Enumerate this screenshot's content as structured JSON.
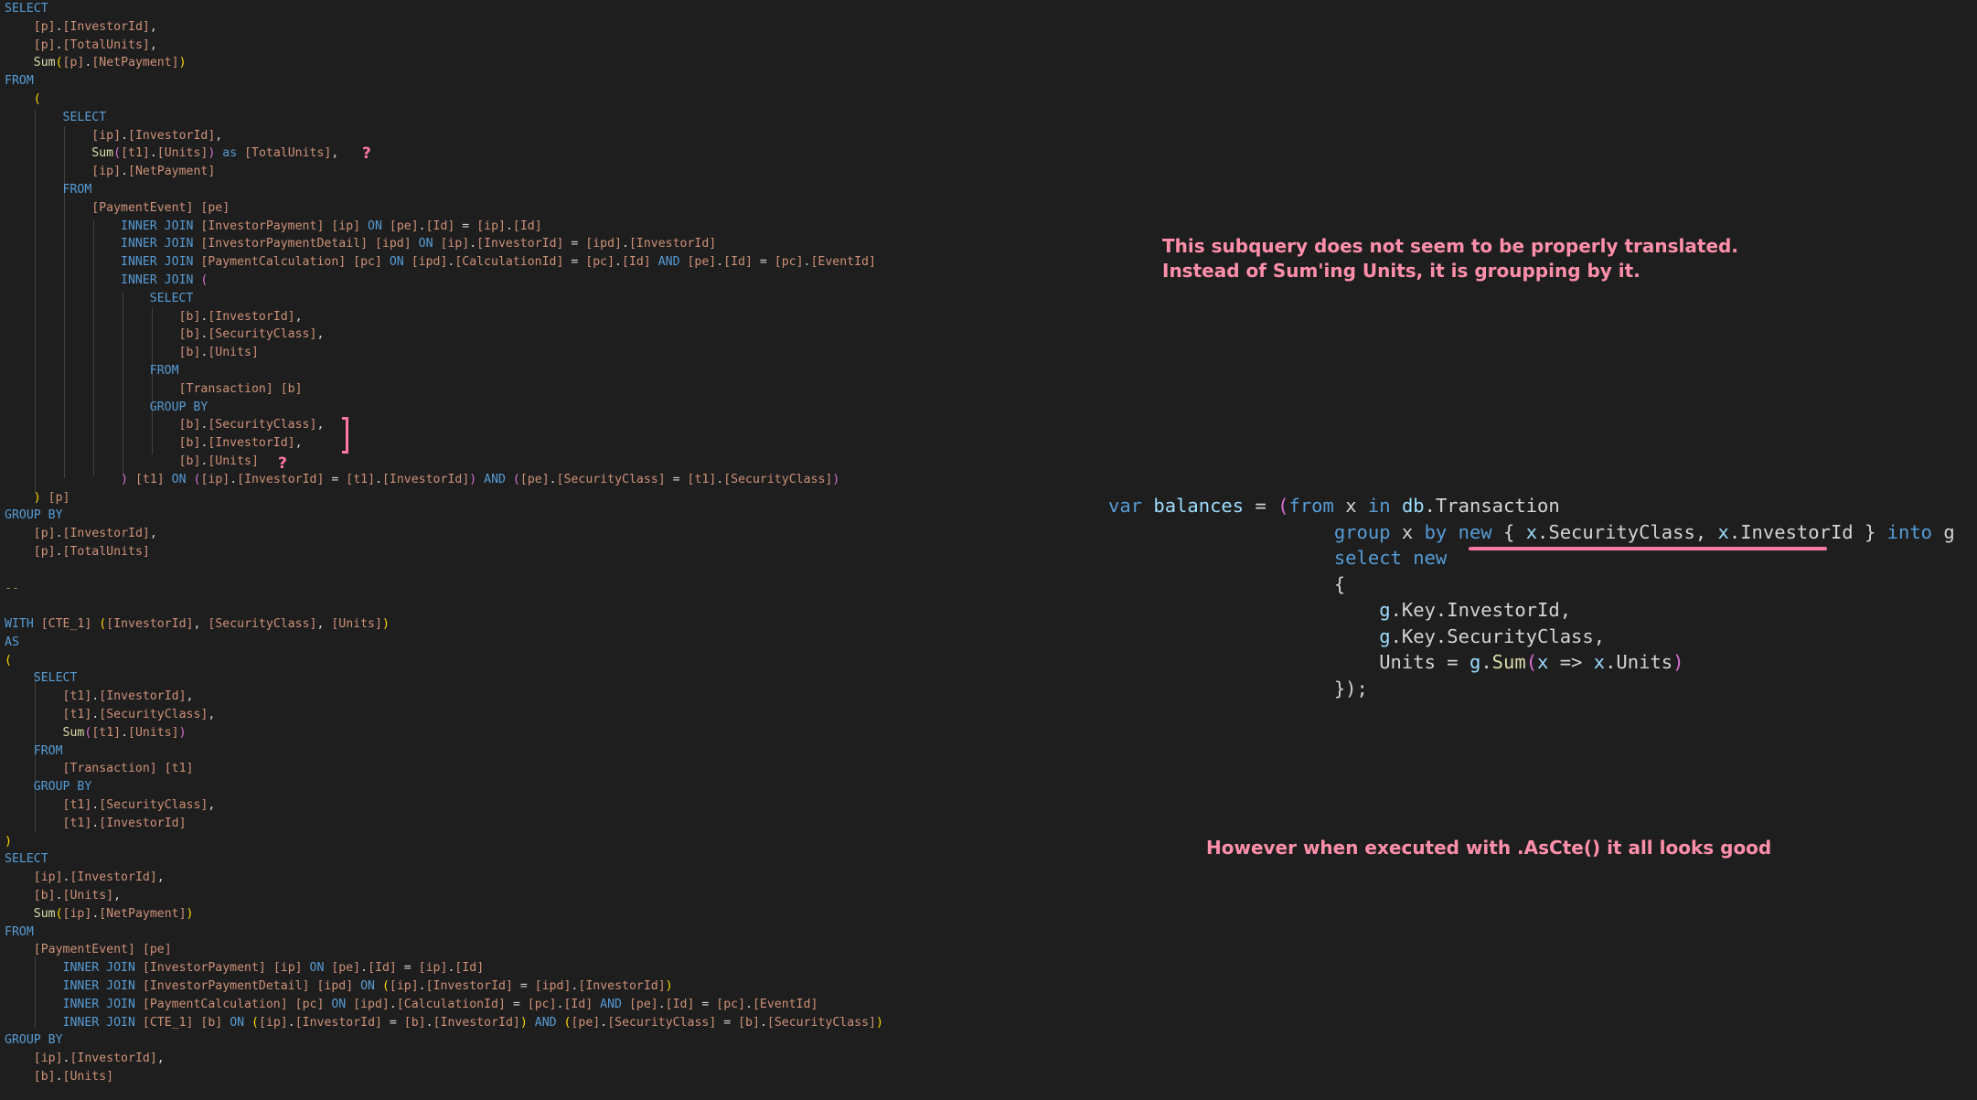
{
  "sql_lines": [
    [
      [
        "SELECT",
        "kw"
      ]
    ],
    [
      [
        "    ",
        ""
      ],
      [
        "[p]",
        "br"
      ],
      [
        ".",
        "pn"
      ],
      [
        "[InvestorId]",
        "br"
      ],
      [
        ",",
        "pn"
      ]
    ],
    [
      [
        "    ",
        ""
      ],
      [
        "[p]",
        "br"
      ],
      [
        ".",
        "pn"
      ],
      [
        "[TotalUnits]",
        "br"
      ],
      [
        ",",
        "pn"
      ]
    ],
    [
      [
        "    ",
        ""
      ],
      [
        "Sum",
        "fn"
      ],
      [
        "(",
        "pa1"
      ],
      [
        "[p]",
        "br"
      ],
      [
        ".",
        "pn"
      ],
      [
        "[NetPayment]",
        "br"
      ],
      [
        ")",
        "pa1"
      ]
    ],
    [
      [
        "FROM",
        "kw"
      ]
    ],
    [
      [
        "    ",
        ""
      ],
      [
        "(",
        "pa1"
      ]
    ],
    [
      [
        "        ",
        ""
      ],
      [
        "SELECT",
        "kw"
      ]
    ],
    [
      [
        "            ",
        ""
      ],
      [
        "[ip]",
        "br"
      ],
      [
        ".",
        "pn"
      ],
      [
        "[InvestorId]",
        "br"
      ],
      [
        ",",
        "pn"
      ]
    ],
    [
      [
        "            ",
        ""
      ],
      [
        "Sum",
        "fn"
      ],
      [
        "(",
        "pa2"
      ],
      [
        "[t1]",
        "br"
      ],
      [
        ".",
        "pn"
      ],
      [
        "[Units]",
        "br"
      ],
      [
        ")",
        "pa2"
      ],
      [
        " as ",
        "kw"
      ],
      [
        "[TotalUnits]",
        "br"
      ],
      [
        ",",
        "pn"
      ]
    ],
    [
      [
        "            ",
        ""
      ],
      [
        "[ip]",
        "br"
      ],
      [
        ".",
        "pn"
      ],
      [
        "[NetPayment]",
        "br"
      ]
    ],
    [
      [
        "        ",
        ""
      ],
      [
        "FROM",
        "kw"
      ]
    ],
    [
      [
        "            ",
        ""
      ],
      [
        "[PaymentEvent]",
        "br"
      ],
      [
        " ",
        ""
      ],
      [
        "[pe]",
        "br"
      ]
    ],
    [
      [
        "                ",
        ""
      ],
      [
        "INNER JOIN",
        "kw"
      ],
      [
        " ",
        ""
      ],
      [
        "[InvestorPayment]",
        "br"
      ],
      [
        " ",
        ""
      ],
      [
        "[ip]",
        "br"
      ],
      [
        " ON ",
        "kw"
      ],
      [
        "[pe]",
        "br"
      ],
      [
        ".",
        "pn"
      ],
      [
        "[Id]",
        "br"
      ],
      [
        " = ",
        "pn"
      ],
      [
        "[ip]",
        "br"
      ],
      [
        ".",
        "pn"
      ],
      [
        "[Id]",
        "br"
      ]
    ],
    [
      [
        "                ",
        ""
      ],
      [
        "INNER JOIN",
        "kw"
      ],
      [
        " ",
        ""
      ],
      [
        "[InvestorPaymentDetail]",
        "br"
      ],
      [
        " ",
        ""
      ],
      [
        "[ipd]",
        "br"
      ],
      [
        " ON ",
        "kw"
      ],
      [
        "[ip]",
        "br"
      ],
      [
        ".",
        "pn"
      ],
      [
        "[InvestorId]",
        "br"
      ],
      [
        " = ",
        "pn"
      ],
      [
        "[ipd]",
        "br"
      ],
      [
        ".",
        "pn"
      ],
      [
        "[InvestorId]",
        "br"
      ]
    ],
    [
      [
        "                ",
        ""
      ],
      [
        "INNER JOIN",
        "kw"
      ],
      [
        " ",
        ""
      ],
      [
        "[PaymentCalculation]",
        "br"
      ],
      [
        " ",
        ""
      ],
      [
        "[pc]",
        "br"
      ],
      [
        " ON ",
        "kw"
      ],
      [
        "[ipd]",
        "br"
      ],
      [
        ".",
        "pn"
      ],
      [
        "[CalculationId]",
        "br"
      ],
      [
        " = ",
        "pn"
      ],
      [
        "[pc]",
        "br"
      ],
      [
        ".",
        "pn"
      ],
      [
        "[Id]",
        "br"
      ],
      [
        " AND ",
        "kw"
      ],
      [
        "[pe]",
        "br"
      ],
      [
        ".",
        "pn"
      ],
      [
        "[Id]",
        "br"
      ],
      [
        " = ",
        "pn"
      ],
      [
        "[pc]",
        "br"
      ],
      [
        ".",
        "pn"
      ],
      [
        "[EventId]",
        "br"
      ]
    ],
    [
      [
        "                ",
        ""
      ],
      [
        "INNER JOIN",
        "kw"
      ],
      [
        " ",
        ""
      ],
      [
        "(",
        "pa2"
      ]
    ],
    [
      [
        "                    ",
        ""
      ],
      [
        "SELECT",
        "kw"
      ]
    ],
    [
      [
        "                        ",
        ""
      ],
      [
        "[b]",
        "br"
      ],
      [
        ".",
        "pn"
      ],
      [
        "[InvestorId]",
        "br"
      ],
      [
        ",",
        "pn"
      ]
    ],
    [
      [
        "                        ",
        ""
      ],
      [
        "[b]",
        "br"
      ],
      [
        ".",
        "pn"
      ],
      [
        "[SecurityClass]",
        "br"
      ],
      [
        ",",
        "pn"
      ]
    ],
    [
      [
        "                        ",
        ""
      ],
      [
        "[b]",
        "br"
      ],
      [
        ".",
        "pn"
      ],
      [
        "[Units]",
        "br"
      ]
    ],
    [
      [
        "                    ",
        ""
      ],
      [
        "FROM",
        "kw"
      ]
    ],
    [
      [
        "                        ",
        ""
      ],
      [
        "[Transaction]",
        "br"
      ],
      [
        " ",
        ""
      ],
      [
        "[b]",
        "br"
      ]
    ],
    [
      [
        "                    ",
        ""
      ],
      [
        "GROUP BY",
        "kw"
      ]
    ],
    [
      [
        "                        ",
        ""
      ],
      [
        "[b]",
        "br"
      ],
      [
        ".",
        "pn"
      ],
      [
        "[SecurityClass]",
        "br"
      ],
      [
        ",",
        "pn"
      ]
    ],
    [
      [
        "                        ",
        ""
      ],
      [
        "[b]",
        "br"
      ],
      [
        ".",
        "pn"
      ],
      [
        "[InvestorId]",
        "br"
      ],
      [
        ",",
        "pn"
      ]
    ],
    [
      [
        "                        ",
        ""
      ],
      [
        "[b]",
        "br"
      ],
      [
        ".",
        "pn"
      ],
      [
        "[Units]",
        "br"
      ]
    ],
    [
      [
        "                ",
        ""
      ],
      [
        ")",
        "pa2"
      ],
      [
        " ",
        ""
      ],
      [
        "[t1]",
        "br"
      ],
      [
        " ON ",
        "kw"
      ],
      [
        "(",
        "pa2"
      ],
      [
        "[ip]",
        "br"
      ],
      [
        ".",
        "pn"
      ],
      [
        "[InvestorId]",
        "br"
      ],
      [
        " = ",
        "pn"
      ],
      [
        "[t1]",
        "br"
      ],
      [
        ".",
        "pn"
      ],
      [
        "[InvestorId]",
        "br"
      ],
      [
        ")",
        "pa2"
      ],
      [
        " AND ",
        "kw"
      ],
      [
        "(",
        "pa2"
      ],
      [
        "[pe]",
        "br"
      ],
      [
        ".",
        "pn"
      ],
      [
        "[SecurityClass]",
        "br"
      ],
      [
        " = ",
        "pn"
      ],
      [
        "[t1]",
        "br"
      ],
      [
        ".",
        "pn"
      ],
      [
        "[SecurityClass]",
        "br"
      ],
      [
        ")",
        "pa2"
      ]
    ],
    [
      [
        "    ",
        ""
      ],
      [
        ")",
        "pa1"
      ],
      [
        " ",
        ""
      ],
      [
        "[p]",
        "br"
      ]
    ],
    [
      [
        "GROUP BY",
        "kw"
      ]
    ],
    [
      [
        "    ",
        ""
      ],
      [
        "[p]",
        "br"
      ],
      [
        ".",
        "pn"
      ],
      [
        "[InvestorId]",
        "br"
      ],
      [
        ",",
        "pn"
      ]
    ],
    [
      [
        "    ",
        ""
      ],
      [
        "[p]",
        "br"
      ],
      [
        ".",
        "pn"
      ],
      [
        "[TotalUnits]",
        "br"
      ]
    ],
    [
      [
        "",
        ""
      ]
    ],
    [
      [
        "--",
        "cm"
      ]
    ],
    [
      [
        "",
        ""
      ]
    ],
    [
      [
        "WITH",
        "kw"
      ],
      [
        " ",
        ""
      ],
      [
        "[CTE_1]",
        "br"
      ],
      [
        " ",
        ""
      ],
      [
        "(",
        "pa1"
      ],
      [
        "[InvestorId]",
        "br"
      ],
      [
        ", ",
        "pn"
      ],
      [
        "[SecurityClass]",
        "br"
      ],
      [
        ", ",
        "pn"
      ],
      [
        "[Units]",
        "br"
      ],
      [
        ")",
        "pa1"
      ]
    ],
    [
      [
        "AS",
        "kw"
      ]
    ],
    [
      [
        "(",
        "pa1"
      ]
    ],
    [
      [
        "    ",
        ""
      ],
      [
        "SELECT",
        "kw"
      ]
    ],
    [
      [
        "        ",
        ""
      ],
      [
        "[t1]",
        "br"
      ],
      [
        ".",
        "pn"
      ],
      [
        "[InvestorId]",
        "br"
      ],
      [
        ",",
        "pn"
      ]
    ],
    [
      [
        "        ",
        ""
      ],
      [
        "[t1]",
        "br"
      ],
      [
        ".",
        "pn"
      ],
      [
        "[SecurityClass]",
        "br"
      ],
      [
        ",",
        "pn"
      ]
    ],
    [
      [
        "        ",
        ""
      ],
      [
        "Sum",
        "fn"
      ],
      [
        "(",
        "pa2"
      ],
      [
        "[t1]",
        "br"
      ],
      [
        ".",
        "pn"
      ],
      [
        "[Units]",
        "br"
      ],
      [
        ")",
        "pa2"
      ]
    ],
    [
      [
        "    ",
        ""
      ],
      [
        "FROM",
        "kw"
      ]
    ],
    [
      [
        "        ",
        ""
      ],
      [
        "[Transaction]",
        "br"
      ],
      [
        " ",
        ""
      ],
      [
        "[t1]",
        "br"
      ]
    ],
    [
      [
        "    ",
        ""
      ],
      [
        "GROUP BY",
        "kw"
      ]
    ],
    [
      [
        "        ",
        ""
      ],
      [
        "[t1]",
        "br"
      ],
      [
        ".",
        "pn"
      ],
      [
        "[SecurityClass]",
        "br"
      ],
      [
        ",",
        "pn"
      ]
    ],
    [
      [
        "        ",
        ""
      ],
      [
        "[t1]",
        "br"
      ],
      [
        ".",
        "pn"
      ],
      [
        "[InvestorId]",
        "br"
      ]
    ],
    [
      [
        ")",
        "pa1"
      ]
    ],
    [
      [
        "SELECT",
        "kw"
      ]
    ],
    [
      [
        "    ",
        ""
      ],
      [
        "[ip]",
        "br"
      ],
      [
        ".",
        "pn"
      ],
      [
        "[InvestorId]",
        "br"
      ],
      [
        ",",
        "pn"
      ]
    ],
    [
      [
        "    ",
        ""
      ],
      [
        "[b]",
        "br"
      ],
      [
        ".",
        "pn"
      ],
      [
        "[Units]",
        "br"
      ],
      [
        ",",
        "pn"
      ]
    ],
    [
      [
        "    ",
        ""
      ],
      [
        "Sum",
        "fn"
      ],
      [
        "(",
        "pa1"
      ],
      [
        "[ip]",
        "br"
      ],
      [
        ".",
        "pn"
      ],
      [
        "[NetPayment]",
        "br"
      ],
      [
        ")",
        "pa1"
      ]
    ],
    [
      [
        "FROM",
        "kw"
      ]
    ],
    [
      [
        "    ",
        ""
      ],
      [
        "[PaymentEvent]",
        "br"
      ],
      [
        " ",
        ""
      ],
      [
        "[pe]",
        "br"
      ]
    ],
    [
      [
        "        ",
        ""
      ],
      [
        "INNER JOIN",
        "kw"
      ],
      [
        " ",
        ""
      ],
      [
        "[InvestorPayment]",
        "br"
      ],
      [
        " ",
        ""
      ],
      [
        "[ip]",
        "br"
      ],
      [
        " ON ",
        "kw"
      ],
      [
        "[pe]",
        "br"
      ],
      [
        ".",
        "pn"
      ],
      [
        "[Id]",
        "br"
      ],
      [
        " = ",
        "pn"
      ],
      [
        "[ip]",
        "br"
      ],
      [
        ".",
        "pn"
      ],
      [
        "[Id]",
        "br"
      ]
    ],
    [
      [
        "        ",
        ""
      ],
      [
        "INNER JOIN",
        "kw"
      ],
      [
        " ",
        ""
      ],
      [
        "[InvestorPaymentDetail]",
        "br"
      ],
      [
        " ",
        ""
      ],
      [
        "[ipd]",
        "br"
      ],
      [
        " ON ",
        "kw"
      ],
      [
        "(",
        "pa1"
      ],
      [
        "[ip]",
        "br"
      ],
      [
        ".",
        "pn"
      ],
      [
        "[InvestorId]",
        "br"
      ],
      [
        " = ",
        "pn"
      ],
      [
        "[ipd]",
        "br"
      ],
      [
        ".",
        "pn"
      ],
      [
        "[InvestorId]",
        "br"
      ],
      [
        ")",
        "pa1"
      ]
    ],
    [
      [
        "        ",
        ""
      ],
      [
        "INNER JOIN",
        "kw"
      ],
      [
        " ",
        ""
      ],
      [
        "[PaymentCalculation]",
        "br"
      ],
      [
        " ",
        ""
      ],
      [
        "[pc]",
        "br"
      ],
      [
        " ON ",
        "kw"
      ],
      [
        "[ipd]",
        "br"
      ],
      [
        ".",
        "pn"
      ],
      [
        "[CalculationId]",
        "br"
      ],
      [
        " = ",
        "pn"
      ],
      [
        "[pc]",
        "br"
      ],
      [
        ".",
        "pn"
      ],
      [
        "[Id]",
        "br"
      ],
      [
        " AND ",
        "kw"
      ],
      [
        "[pe]",
        "br"
      ],
      [
        ".",
        "pn"
      ],
      [
        "[Id]",
        "br"
      ],
      [
        " = ",
        "pn"
      ],
      [
        "[pc]",
        "br"
      ],
      [
        ".",
        "pn"
      ],
      [
        "[EventId]",
        "br"
      ]
    ],
    [
      [
        "        ",
        ""
      ],
      [
        "INNER JOIN",
        "kw"
      ],
      [
        " ",
        ""
      ],
      [
        "[CTE_1]",
        "br"
      ],
      [
        " ",
        ""
      ],
      [
        "[b]",
        "br"
      ],
      [
        " ON ",
        "kw"
      ],
      [
        "(",
        "pa1"
      ],
      [
        "[ip]",
        "br"
      ],
      [
        ".",
        "pn"
      ],
      [
        "[InvestorId]",
        "br"
      ],
      [
        " = ",
        "pn"
      ],
      [
        "[b]",
        "br"
      ],
      [
        ".",
        "pn"
      ],
      [
        "[InvestorId]",
        "br"
      ],
      [
        ")",
        "pa1"
      ],
      [
        " AND ",
        "kw"
      ],
      [
        "(",
        "pa1"
      ],
      [
        "[pe]",
        "br"
      ],
      [
        ".",
        "pn"
      ],
      [
        "[SecurityClass]",
        "br"
      ],
      [
        " = ",
        "pn"
      ],
      [
        "[b]",
        "br"
      ],
      [
        ".",
        "pn"
      ],
      [
        "[SecurityClass]",
        "br"
      ],
      [
        ")",
        "pa1"
      ]
    ],
    [
      [
        "GROUP BY",
        "kw"
      ]
    ],
    [
      [
        "    ",
        ""
      ],
      [
        "[ip]",
        "br"
      ],
      [
        ".",
        "pn"
      ],
      [
        "[InvestorId]",
        "br"
      ],
      [
        ",",
        "pn"
      ]
    ],
    [
      [
        "    ",
        ""
      ],
      [
        "[b]",
        "br"
      ],
      [
        ".",
        "pn"
      ],
      [
        "[Units]",
        "br"
      ]
    ]
  ],
  "annotations": {
    "question_mark": "?",
    "note_line1": "This subquery does not seem to be properly translated.",
    "note_line2": "Instead of Sum'ing Units, it is groupping by it.",
    "ascte_note": "However when executed with .AsCte() it all looks good"
  },
  "csharp_lines": [
    [
      [
        "var",
        "cs-kw"
      ],
      [
        " ",
        "cs-pn"
      ],
      [
        "balances",
        "cs-var"
      ],
      [
        " = ",
        "cs-pn"
      ],
      [
        "(",
        "cs-pa"
      ],
      [
        "from",
        "cs-kw"
      ],
      [
        " x ",
        "cs-pn"
      ],
      [
        "in",
        "cs-kw"
      ],
      [
        " ",
        "cs-pn"
      ],
      [
        "db",
        "cs-var"
      ],
      [
        ".Transaction",
        "cs-pn"
      ]
    ],
    [
      [
        "                    ",
        "cs-pn"
      ],
      [
        "group",
        "cs-kw"
      ],
      [
        " x ",
        "cs-pn"
      ],
      [
        "by",
        "cs-kw"
      ],
      [
        " ",
        "cs-pn"
      ],
      [
        "new",
        "cs-kw"
      ],
      [
        " { ",
        "cs-pn"
      ],
      [
        "x",
        "cs-var"
      ],
      [
        ".SecurityClass, ",
        "cs-pn"
      ],
      [
        "x",
        "cs-var"
      ],
      [
        ".InvestorId",
        "cs-pn"
      ],
      [
        " } ",
        "cs-pn"
      ],
      [
        "into",
        "cs-kw"
      ],
      [
        " g",
        "cs-pn"
      ]
    ],
    [
      [
        "                    ",
        "cs-pn"
      ],
      [
        "select",
        "cs-kw"
      ],
      [
        " ",
        "cs-pn"
      ],
      [
        "new",
        "cs-kw"
      ]
    ],
    [
      [
        "                    ",
        "cs-pn"
      ],
      [
        "{",
        "cs-pn"
      ]
    ],
    [
      [
        "                        ",
        "cs-pn"
      ],
      [
        "g",
        "cs-var"
      ],
      [
        ".Key.InvestorId,",
        "cs-pn"
      ]
    ],
    [
      [
        "                        ",
        "cs-pn"
      ],
      [
        "g",
        "cs-var"
      ],
      [
        ".Key.SecurityClass,",
        "cs-pn"
      ]
    ],
    [
      [
        "                        ",
        "cs-pn"
      ],
      [
        "Units = ",
        "cs-pn"
      ],
      [
        "g",
        "cs-var"
      ],
      [
        ".",
        "cs-pn"
      ],
      [
        "Sum",
        "cs-fn"
      ],
      [
        "(",
        "cs-pa"
      ],
      [
        "x",
        "cs-var"
      ],
      [
        " => ",
        "cs-pn"
      ],
      [
        "x",
        "cs-var"
      ],
      [
        ".Units",
        "cs-pn"
      ],
      [
        ")",
        "cs-pa"
      ]
    ],
    [
      [
        "                    ",
        "cs-pn"
      ],
      [
        "});",
        "cs-pn"
      ]
    ]
  ],
  "colors": {
    "background": "#1e1e1e",
    "annotation_pink": "#ff8fab",
    "sql_keyword": "#569cd6",
    "sql_identifier": "#ce9178"
  }
}
